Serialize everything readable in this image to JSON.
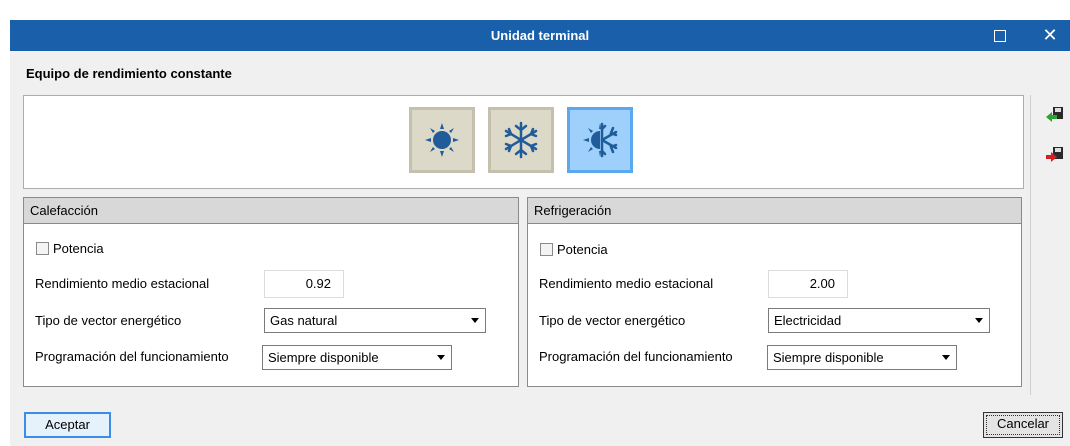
{
  "window": {
    "title": "Unidad terminal",
    "maximize_icon": "maximize-icon",
    "close_glyph": "✕"
  },
  "header": {
    "label": "Equipo de rendimiento constante"
  },
  "modes": [
    {
      "name": "Calefacción",
      "icon": "sun-icon",
      "selected": false
    },
    {
      "name": "Refrigeración",
      "icon": "snowflake-icon",
      "selected": false
    },
    {
      "name": "Calefacción y refrigeración",
      "icon": "sun-snowflake-icon",
      "selected": true
    }
  ],
  "heating": {
    "title": "Calefacción",
    "potencia_label": "Potencia",
    "potencia_checked": false,
    "rendimiento_label": "Rendimiento medio estacional",
    "rendimiento_value": "0.92",
    "vector_label": "Tipo de vector energético",
    "vector_value": "Gas natural",
    "programacion_label": "Programación del funcionamiento",
    "programacion_value": "Siempre disponible"
  },
  "cooling": {
    "title": "Refrigeración",
    "potencia_label": "Potencia",
    "potencia_checked": false,
    "rendimiento_label": "Rendimiento medio estacional",
    "rendimiento_value": "2.00",
    "vector_label": "Tipo de vector energético",
    "vector_value": "Electricidad",
    "programacion_label": "Programación del funcionamiento",
    "programacion_value": "Siempre disponible"
  },
  "side_tools": [
    {
      "icon": "import-icon",
      "color": "#2fa32f"
    },
    {
      "icon": "export-icon",
      "color": "#d42020"
    }
  ],
  "footer": {
    "accept_label": "Aceptar",
    "cancel_label": "Cancelar"
  },
  "colors": {
    "titlebar": "#1a5faa",
    "mode_icon": "#1f5c99",
    "mode_active_bg": "#9fcffb"
  }
}
